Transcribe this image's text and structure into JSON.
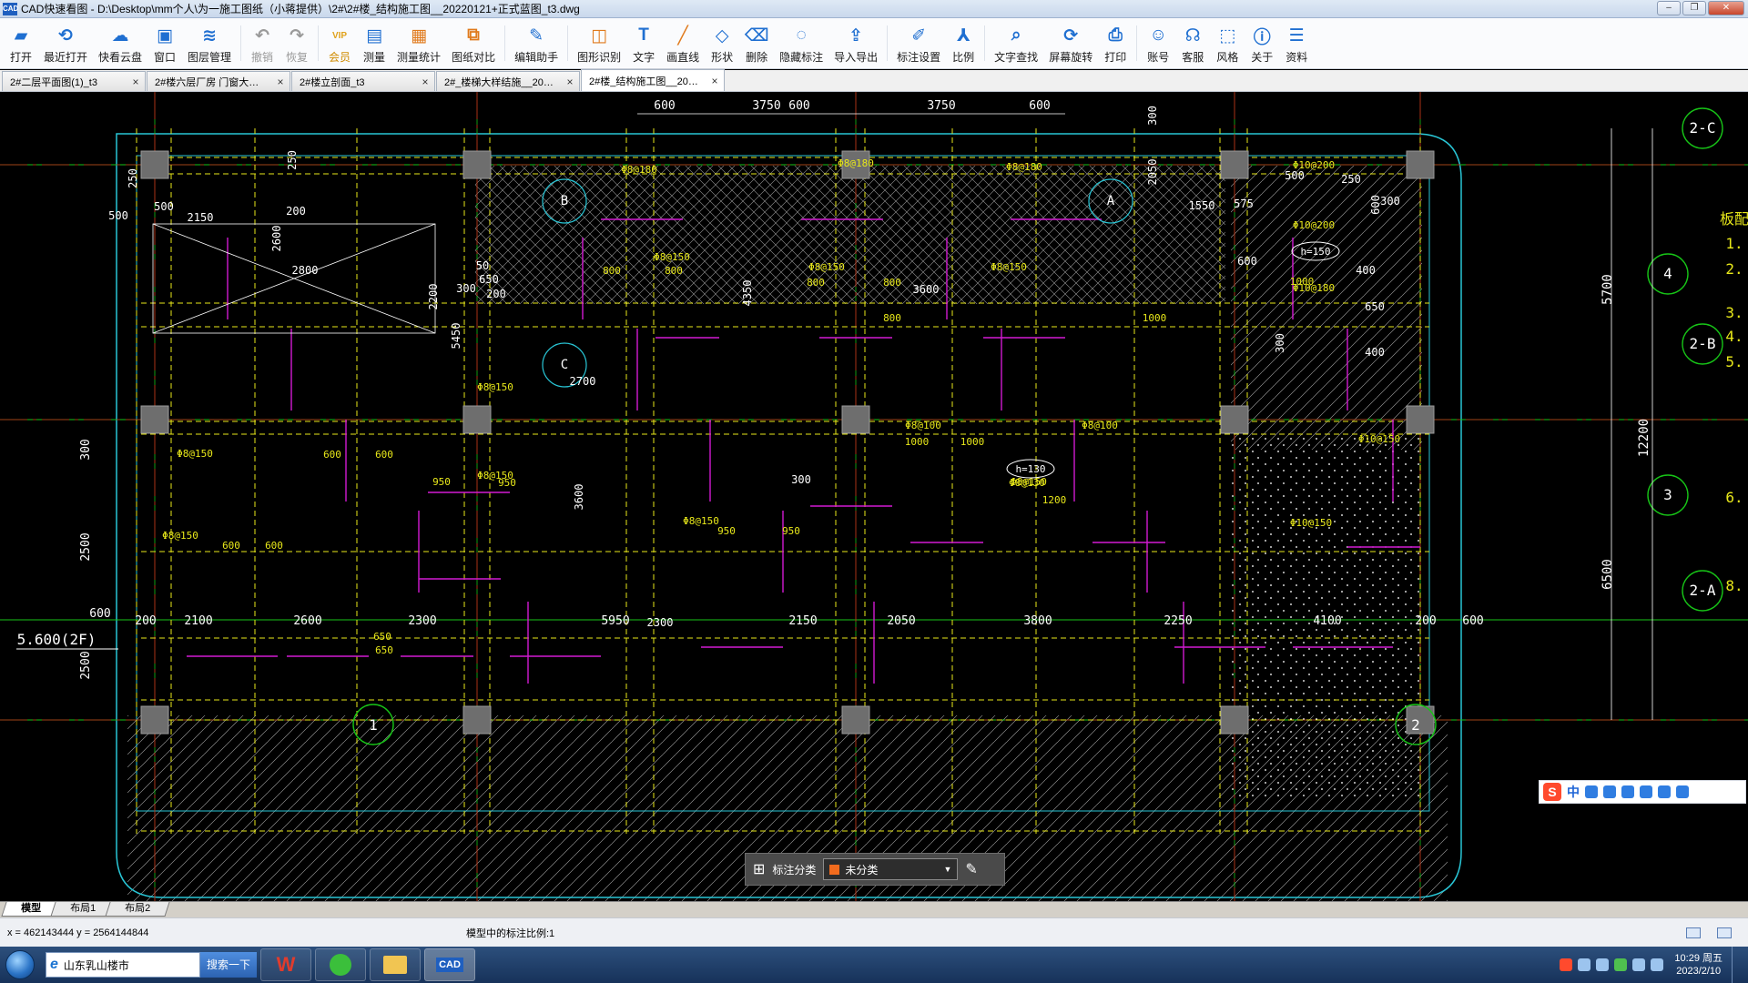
{
  "window": {
    "title": "CAD快速看图 - D:\\Desktop\\mm个人\\为一施工图纸（小蒋提供）\\2#\\2#楼_结构施工图__20220121+正式蓝图_t3.dwg",
    "app_icon": "CAD"
  },
  "toolbar": [
    {
      "id": "open",
      "label": "打开",
      "icon": "folder-open-icon",
      "color": "#1f6fd1"
    },
    {
      "id": "recent",
      "label": "最近打开",
      "icon": "history-icon",
      "color": "#1f6fd1"
    },
    {
      "id": "cloud",
      "label": "快看云盘",
      "icon": "cloud-icon",
      "color": "#1f6fd1"
    },
    {
      "id": "window",
      "label": "窗口",
      "icon": "window-icon",
      "color": "#1f6fd1"
    },
    {
      "id": "layers",
      "label": "图层管理",
      "icon": "layers-icon",
      "color": "#1f6fd1"
    },
    {
      "id": "undo",
      "label": "撤销",
      "icon": "undo-icon",
      "color": "#9a9a9a",
      "disabled": true
    },
    {
      "id": "redo",
      "label": "恢复",
      "icon": "redo-icon",
      "color": "#9a9a9a",
      "disabled": true
    },
    {
      "id": "vip",
      "label": "会员",
      "icon": "vip-icon",
      "color": "#e0a21c",
      "label_color": "#d08b00"
    },
    {
      "id": "measure",
      "label": "测量",
      "icon": "ruler-icon",
      "color": "#1f6fd1"
    },
    {
      "id": "measure-stat",
      "label": "测量统计",
      "icon": "measure-stat-icon",
      "color": "#e07a1c"
    },
    {
      "id": "compare",
      "label": "图纸对比",
      "icon": "compare-icon",
      "color": "#e07a1c"
    },
    {
      "id": "assistant",
      "label": "编辑助手",
      "icon": "edit-assistant-icon",
      "color": "#1f6fd1"
    },
    {
      "id": "recognize",
      "label": "图形识别",
      "icon": "shape-recognize-icon",
      "color": "#e07a1c"
    },
    {
      "id": "text",
      "label": "文字",
      "icon": "text-icon",
      "color": "#1f6fd1"
    },
    {
      "id": "line",
      "label": "画直线",
      "icon": "line-icon",
      "color": "#e07a1c"
    },
    {
      "id": "shape",
      "label": "形状",
      "icon": "shape-icon",
      "color": "#1f6fd1"
    },
    {
      "id": "delete",
      "label": "删除",
      "icon": "eraser-icon",
      "color": "#1f6fd1"
    },
    {
      "id": "hide",
      "label": "隐藏标注",
      "icon": "hide-icon",
      "color": "#1f6fd1"
    },
    {
      "id": "export",
      "label": "导入导出",
      "icon": "export-icon",
      "color": "#1f6fd1"
    },
    {
      "id": "anno-settings",
      "label": "标注设置",
      "icon": "annotation-settings-icon",
      "color": "#1f6fd1"
    },
    {
      "id": "scale",
      "label": "比例",
      "icon": "scale-icon",
      "color": "#1f6fd1"
    },
    {
      "id": "find-text",
      "label": "文字查找",
      "icon": "find-text-icon",
      "color": "#1f6fd1"
    },
    {
      "id": "rotate",
      "label": "屏幕旋转",
      "icon": "rotate-screen-icon",
      "color": "#1f6fd1"
    },
    {
      "id": "print",
      "label": "打印",
      "icon": "printer-icon",
      "color": "#1f6fd1"
    },
    {
      "id": "account",
      "label": "账号",
      "icon": "user-icon",
      "color": "#1f6fd1"
    },
    {
      "id": "service",
      "label": "客服",
      "icon": "headset-icon",
      "color": "#1f6fd1"
    },
    {
      "id": "style",
      "label": "风格",
      "icon": "style-icon",
      "color": "#1f6fd1"
    },
    {
      "id": "about",
      "label": "关于",
      "icon": "info-icon",
      "color": "#1f6fd1"
    },
    {
      "id": "docs",
      "label": "资料",
      "icon": "docs-icon",
      "color": "#1f6fd1"
    }
  ],
  "tabs": [
    {
      "label": "2#二层平面图(1)_t3",
      "active": false
    },
    {
      "label": "2#楼六层厂房 门窗大…",
      "active": false
    },
    {
      "label": "2#楼立剖面_t3",
      "active": false
    },
    {
      "label": "2#_楼梯大样结施__20…",
      "active": false
    },
    {
      "label": "2#楼_结构施工图__20…",
      "active": true
    }
  ],
  "tab_close_glyph": "×",
  "drawing": {
    "colors": {
      "axis": "#d01818",
      "grid": "#17c417",
      "beam": "#e8e81a",
      "rebar": "#d21ad2",
      "dim": "#ffffff",
      "boundary": "#29c6d6",
      "column": "#6e6e6e",
      "hatch": "#a8a8a8"
    },
    "top_dims": [
      "600",
      "3750",
      "600",
      "3750",
      "600"
    ],
    "bottom_dims": [
      "200",
      "2100",
      "2600",
      "2300",
      "5950",
      "2150",
      "2050",
      "3800",
      "2250",
      "4100",
      "200",
      "600"
    ],
    "left_dims": [
      "2500",
      "600",
      "2500",
      "300"
    ],
    "right_dims": [
      "5700",
      "12200",
      "6500"
    ],
    "axis_bubbles_right": [
      "2-C",
      "4",
      "2-B",
      "3",
      "2-A"
    ],
    "axis_bubbles_bottom": [
      "1",
      "2"
    ],
    "section_marks": [
      "A",
      "B",
      "C"
    ],
    "right_notes": [
      "板配",
      "1.",
      "2.",
      "3.",
      "4.",
      "5.",
      "6.",
      "8."
    ],
    "level_mark": "5.600(2F)",
    "misc_dims": [
      "500",
      "250",
      "2150",
      "200",
      "2600",
      "500",
      "2800",
      "2200",
      "300",
      "200",
      "5450",
      "650",
      "50",
      "4350",
      "3600",
      "2700",
      "3600",
      "2300",
      "300",
      "2050",
      "1550",
      "575",
      "300",
      "650",
      "400",
      "300",
      "250",
      "400",
      "250",
      "500",
      "600",
      "600",
      "300"
    ],
    "rebar_labels": [
      "Φ8@180",
      "Φ8@180",
      "Φ8@180",
      "Φ8@150",
      "Φ8@150",
      "Φ8@150",
      "Φ8@150",
      "Φ8@150",
      "Φ8@150",
      "Φ8@150",
      "Φ8@100",
      "Φ8@100",
      "Φ8@130",
      "Φ10@200",
      "Φ10@200",
      "Φ10@180",
      "Φ10@150",
      "Φ10@150",
      "Φ8@150",
      "Φ8@150"
    ],
    "beam_labels": [
      "800",
      "800",
      "800",
      "800",
      "950",
      "950",
      "1000",
      "1000",
      "600",
      "600",
      "650",
      "650",
      "800",
      "1000",
      "600",
      "600",
      "950",
      "950",
      "1200",
      "1000"
    ],
    "slab_thickness": [
      "h=150",
      "h=130"
    ]
  },
  "annotation_panel": {
    "label": "标注分类",
    "value": "未分类",
    "swatch_color": "#f26b1d"
  },
  "ime": {
    "text": "中"
  },
  "layout_tabs": [
    {
      "label": "模型",
      "active": true
    },
    {
      "label": "布局1",
      "active": false
    },
    {
      "label": "布局2",
      "active": false
    }
  ],
  "status": {
    "coords": "x = 462143444  y = 2564144844",
    "scale": "模型中的标注比例:1"
  },
  "taskbar": {
    "ie_text": "山东乳山楼市",
    "search_label": "搜索一下",
    "clock_time": "10:29 周五",
    "clock_date": "2023/2/10",
    "apps": [
      "wps-icon",
      "app360-icon",
      "folder-icon",
      "cad-icon"
    ]
  }
}
